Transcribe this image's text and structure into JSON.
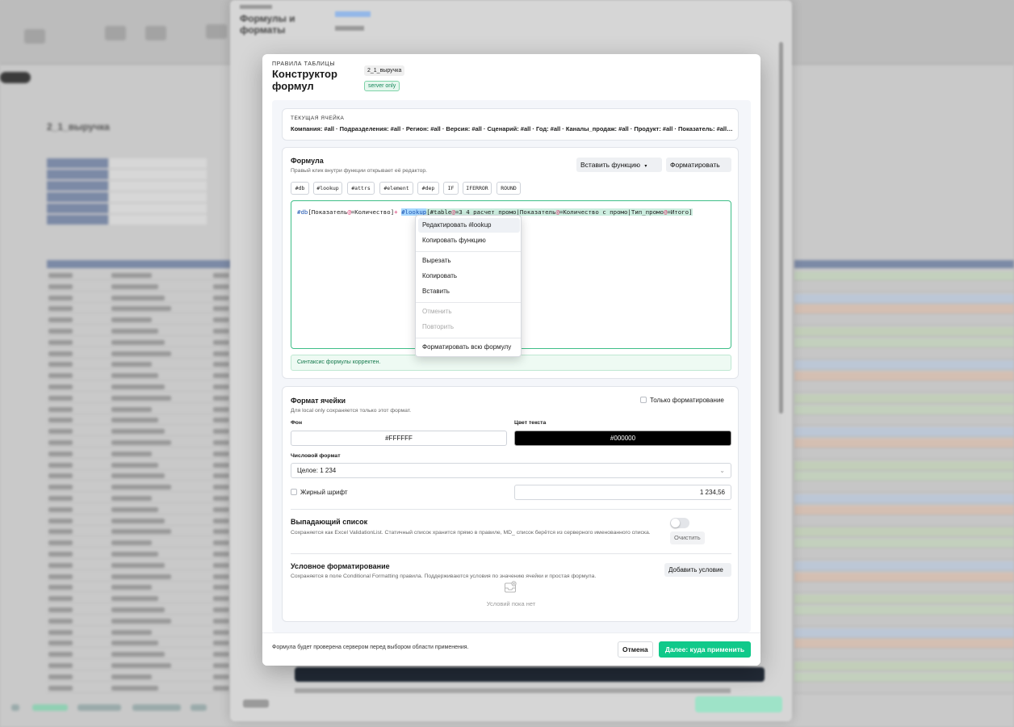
{
  "modal": {
    "eyebrow": "ПРАВИЛА ТАБЛИЦЫ",
    "title": "Конструктор формул",
    "table_tag": "2_1_выручка",
    "mode_badge": "server only"
  },
  "current_cell": {
    "label": "ТЕКУЩАЯ ЯЧЕЙКА",
    "value": "Компания: #all · Подразделения: #all · Регион: #all · Версия: #all · Сценарий: #all · Год: #all · Каналы_продаж: #all · Продукт: #all · Показатель: #all · Период: #all"
  },
  "formula": {
    "title": "Формула",
    "hint": "Правый клик внутри функции открывает её редактор.",
    "insert_button": "Вставить функцию",
    "format_button": "Форматировать",
    "chips": [
      "#db",
      "#lookup",
      "#attrs",
      "#element",
      "#dep",
      "IF",
      "IFERROR",
      "ROUND"
    ],
    "code": {
      "t1": "#db",
      "t2": "[Показатель",
      "t3": "@",
      "t4": "=Количество]",
      "t5": "+ ",
      "t6": "#lookup",
      "t7": "[#table",
      "t8": "@",
      "t9": "=3_4_расчет_промо|Показатель",
      "t10": "@",
      "t11": "=Количество с промо|Тип_промо",
      "t12": "@",
      "t13": "=Итого]"
    },
    "syntax_status": "Синтаксис формулы корректен."
  },
  "context_menu": {
    "items": [
      {
        "label": "Редактировать #lookup",
        "active": true
      },
      {
        "label": "Копировать функцию"
      },
      {
        "label": "Вырезать"
      },
      {
        "label": "Копировать"
      },
      {
        "label": "Вставить"
      },
      {
        "label": "Отменить",
        "disabled": true
      },
      {
        "label": "Повторить",
        "disabled": true
      },
      {
        "label": "Форматировать всю формулу"
      }
    ]
  },
  "cell_format": {
    "title": "Формат ячейки",
    "note": "Для local only сохраняется только этот формат.",
    "only_formatting_label": "Только форматирование",
    "bg_label": "Фон",
    "bg_value": "#FFFFFF",
    "text_color_label": "Цвет текста",
    "text_color_value": "#000000",
    "number_format_label": "Числовой формат",
    "number_format_value": "Целое: 1 234",
    "bold_label": "Жирный шрифт",
    "sample_value": "1 234,56",
    "dropdown_title": "Выпадающий список",
    "dropdown_note": "Сохраняется как Excel ValidationList. Статичный список хранится прямо в правиле, MD_ список берётся из серверного именованного списка.",
    "clear_button": "Очистить",
    "cond_title": "Условное форматирование",
    "cond_note": "Сохраняется в поле Conditional Formatting правила. Поддерживаются условия по значению ячейки и простая формула.",
    "add_condition_button": "Добавить условие",
    "empty_text": "Условий пока нет"
  },
  "footer": {
    "note": "Формула будет проверена сервером перед выбором области применения.",
    "cancel_button": "Отмена",
    "next_button": "Далее: куда применить"
  },
  "colors": {
    "accent": "#10c98a",
    "function_token": "#1e56b3",
    "at_token": "#e0336e",
    "highlight": "#cdeee0"
  },
  "background": {
    "outer_panel_title": "Формулы и форматы",
    "sheet_title": "2_1_выручка"
  }
}
